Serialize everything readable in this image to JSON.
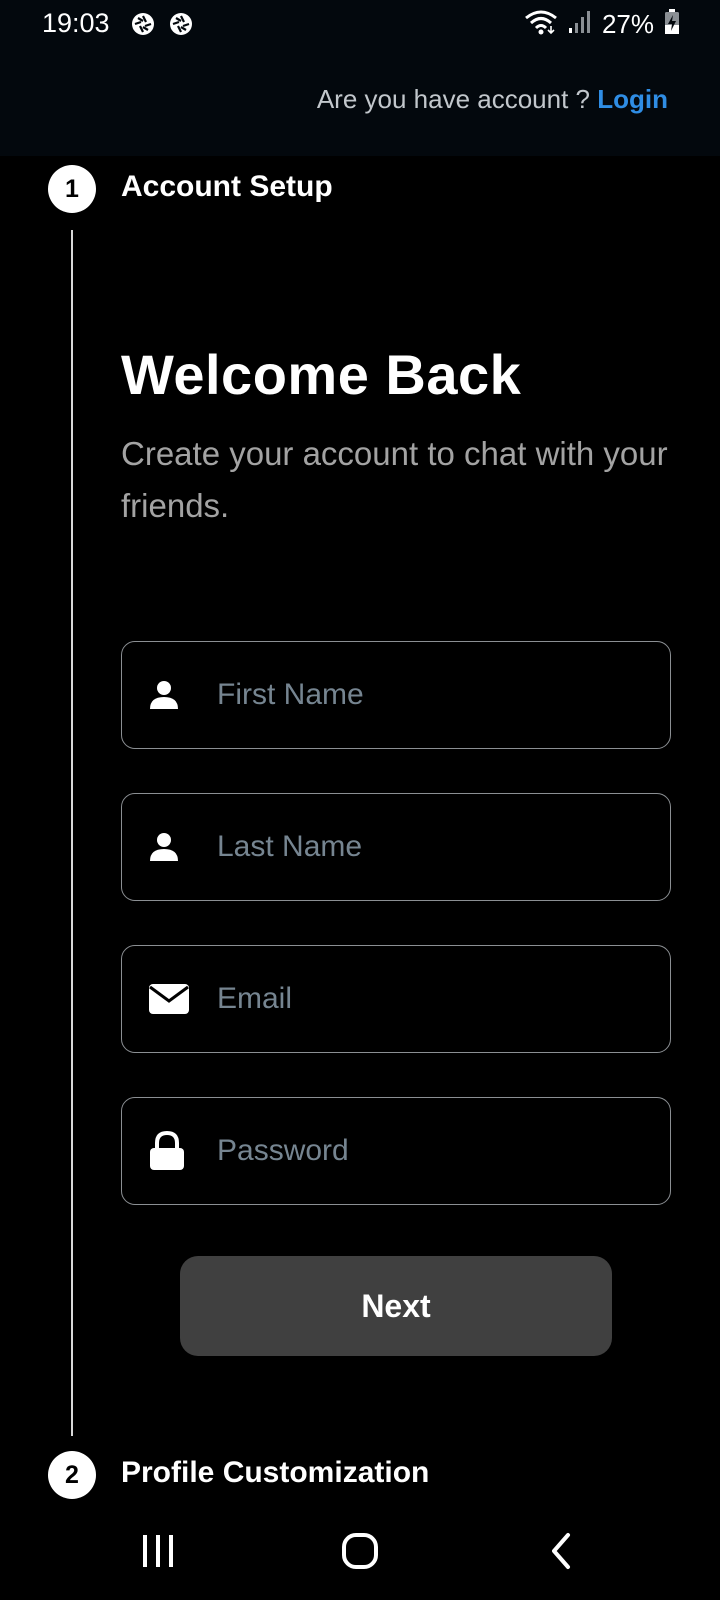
{
  "status_bar": {
    "time": "19:03",
    "battery": "27%",
    "icons": [
      "camera-aperture-icon",
      "camera-aperture-icon",
      "wifi-icon",
      "signal-icon",
      "battery-charging-icon"
    ]
  },
  "header": {
    "login_prompt": "Are you have account ? ",
    "login_link": "Login"
  },
  "steps": [
    {
      "number": "1",
      "label": "Account Setup"
    },
    {
      "number": "2",
      "label": "Profile Customization"
    }
  ],
  "main": {
    "title": "Welcome Back",
    "subtitle": "Create your account to chat with your friends."
  },
  "form": {
    "fields": [
      {
        "icon": "person-icon",
        "placeholder": "First Name",
        "value": ""
      },
      {
        "icon": "person-icon",
        "placeholder": "Last Name",
        "value": ""
      },
      {
        "icon": "envelope-icon",
        "placeholder": "Email",
        "value": ""
      },
      {
        "icon": "lock-icon",
        "placeholder": "Password",
        "value": ""
      }
    ],
    "next_label": "Next"
  },
  "nav_bar": {
    "icons": [
      "recent-apps-icon",
      "home-icon",
      "back-icon"
    ]
  },
  "colors": {
    "background": "#000000",
    "header_background": "#03080d",
    "accent_link": "#2f8de4",
    "placeholder": "#768591",
    "button": "#404040"
  }
}
